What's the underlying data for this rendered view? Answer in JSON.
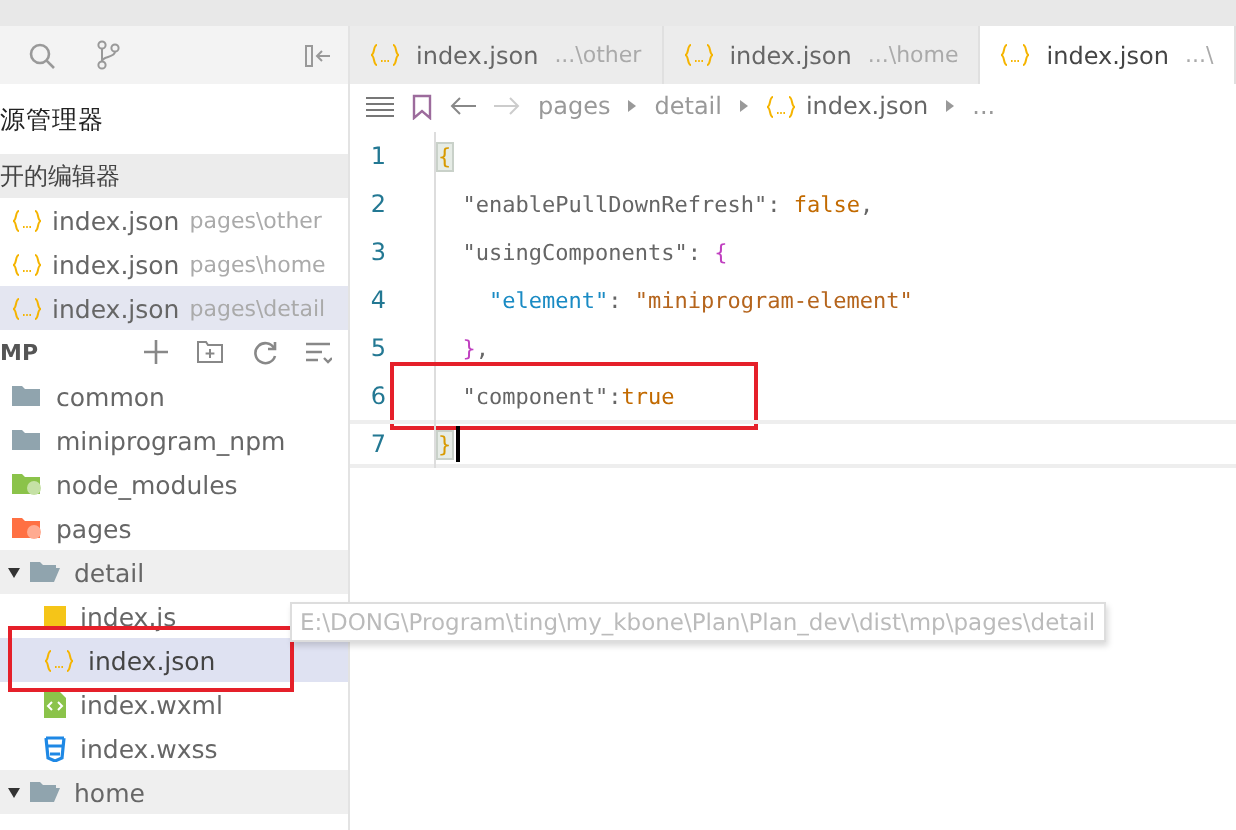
{
  "sidebar": {
    "title": "源管理器",
    "open_editors": {
      "title": "开的编辑器",
      "items": [
        {
          "name": "index.json",
          "path": "pages\\other",
          "selected": false
        },
        {
          "name": "index.json",
          "path": "pages\\home",
          "selected": false
        },
        {
          "name": "index.json",
          "path": "pages\\detail",
          "selected": true
        }
      ]
    },
    "project": {
      "title": "MP",
      "children": [
        {
          "name": "common",
          "kind": "folder",
          "selected": false,
          "highlight": false
        },
        {
          "name": "miniprogram_npm",
          "kind": "folder",
          "selected": false,
          "highlight": false
        },
        {
          "name": "node_modules",
          "kind": "node",
          "selected": false,
          "highlight": false
        },
        {
          "name": "pages",
          "kind": "pages",
          "selected": false,
          "highlight": false,
          "children": [
            {
              "name": "detail",
              "kind": "folder",
              "expanded": true,
              "selected": false,
              "highlight": false,
              "children": [
                {
                  "name": "index.js",
                  "kind": "js",
                  "selected": false,
                  "highlight": false
                },
                {
                  "name": "index.json",
                  "kind": "json",
                  "selected": true,
                  "highlight": true
                },
                {
                  "name": "index.wxml",
                  "kind": "wxml",
                  "selected": false,
                  "highlight": false
                },
                {
                  "name": "index.wxss",
                  "kind": "wxss",
                  "selected": false,
                  "highlight": false
                }
              ]
            },
            {
              "name": "home",
              "kind": "folder",
              "expanded": true,
              "selected": false,
              "highlight": false
            }
          ]
        }
      ]
    }
  },
  "tooltip": "E:\\DONG\\Program\\ting\\my_kbone\\Plan\\Plan_dev\\dist\\mp\\pages\\detail",
  "tabs": [
    {
      "name": "index.json",
      "path": "...\\other",
      "selected": false
    },
    {
      "name": "index.json",
      "path": "...\\home",
      "selected": false
    },
    {
      "name": "index.json",
      "path": "...\\",
      "selected": true
    }
  ],
  "breadcrumb": [
    {
      "text": "pages",
      "kind": "dir"
    },
    {
      "text": "detail",
      "kind": "dir"
    },
    {
      "text": "index.json",
      "kind": "json"
    },
    {
      "text": "...",
      "kind": "more"
    }
  ],
  "code": [
    {
      "number": "1",
      "highlight": false,
      "current": false,
      "tokens": [
        {
          "kind": "match",
          "text": "{"
        }
      ]
    },
    {
      "number": "2",
      "highlight": false,
      "current": false,
      "tokens": [
        {
          "kind": "key",
          "text": "  \"enablePullDownRefresh\""
        },
        {
          "kind": "punct",
          "text": ": "
        },
        {
          "kind": "bool",
          "text": "false"
        },
        {
          "kind": "punct",
          "text": ","
        }
      ]
    },
    {
      "number": "3",
      "highlight": false,
      "current": false,
      "tokens": [
        {
          "kind": "key",
          "text": "  \"usingComponents\""
        },
        {
          "kind": "punct",
          "text": ": "
        },
        {
          "kind": "brace",
          "text": "{"
        }
      ]
    },
    {
      "number": "4",
      "highlight": false,
      "current": false,
      "tokens": [
        {
          "kind": "key2",
          "text": "    \"element\""
        },
        {
          "kind": "punct",
          "text": ": "
        },
        {
          "kind": "string",
          "text": "\"miniprogram-element\""
        }
      ]
    },
    {
      "number": "5",
      "highlight": false,
      "current": false,
      "tokens": [
        {
          "kind": "brace",
          "text": "  }"
        },
        {
          "kind": "punct",
          "text": ","
        }
      ]
    },
    {
      "number": "6",
      "highlight": true,
      "current": false,
      "tokens": [
        {
          "kind": "key",
          "text": "  \"component\""
        },
        {
          "kind": "punct",
          "text": ":"
        },
        {
          "kind": "bool",
          "text": "true"
        }
      ]
    },
    {
      "number": "7",
      "highlight": false,
      "current": true,
      "tokens": [
        {
          "kind": "match",
          "text": "}"
        }
      ]
    }
  ]
}
